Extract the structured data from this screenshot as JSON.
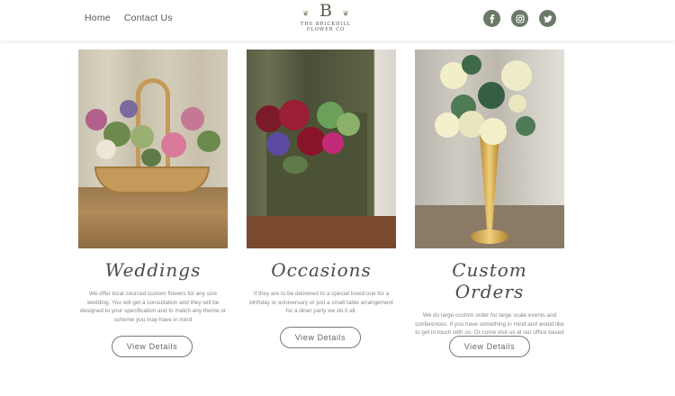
{
  "nav": {
    "home": "Home",
    "contact": "Contact Us"
  },
  "logo": {
    "mark": "B",
    "line1": "THE BRICKHILL",
    "line2": "FLOWER CO"
  },
  "social": [
    "facebook-icon",
    "instagram-icon",
    "twitter-icon"
  ],
  "colors": {
    "social_bg": "#6b7a68",
    "heading": "#4a4a4a",
    "body_text": "#888888"
  },
  "cards": [
    {
      "title": "Weddings",
      "text": "We offer local sourced custom flowers for any size wedding. You will get a consultation and they will be designed to your specification and to match any theme or scheme you may have in mind",
      "button": "View Details"
    },
    {
      "title": "Occasions",
      "text": "If they are to be delivered to a special loved one for a birthday or anniversary or just a small table arrangement for a diner party we do it all.",
      "button": "View Details"
    },
    {
      "title": "Custom Orders",
      "text": "We do large custom order for large scale events and conferences. If you have something in mind and would like to get in touch with us. Or come visit us at our office based in Great Brickhill",
      "button": "View Details"
    }
  ]
}
